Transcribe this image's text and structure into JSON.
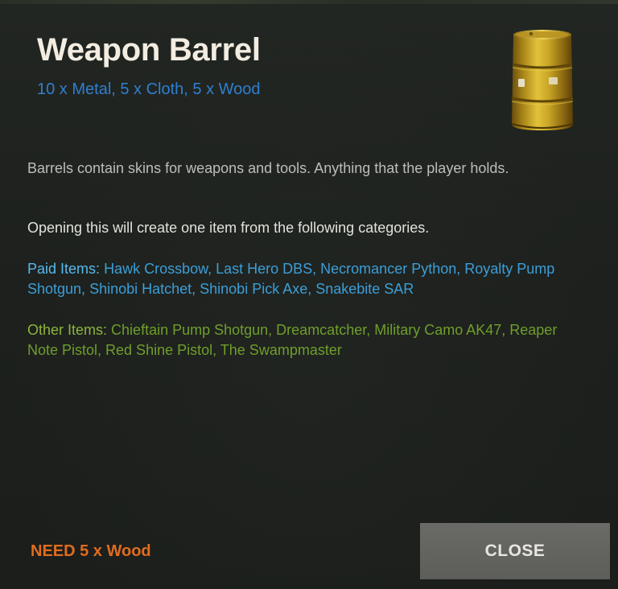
{
  "item": {
    "title": "Weapon Barrel",
    "cost": "10 x Metal, 5 x Cloth, 5 x Wood",
    "image_icon": "barrel-icon"
  },
  "description": "Barrels contain skins for weapons and tools. Anything that the player holds.",
  "intro": "Opening this will create one item from the following categories.",
  "paid_items": {
    "label": "Paid Items:",
    "list": "Hawk Crossbow, Last Hero DBS, Necromancer Python, Royalty Pump Shotgun, Shinobi Hatchet, Shinobi Pick Axe, Snakebite SAR"
  },
  "other_items": {
    "label": "Other Items:",
    "list": "Chieftain Pump Shotgun, Dreamcatcher, Military Camo AK47, Reaper Note Pistol, Red Shine Pistol, The Swampmaster"
  },
  "footer": {
    "need_text": "NEED 5 x Wood",
    "close_label": "CLOSE"
  },
  "colors": {
    "title": "#f3ece1",
    "cost": "#2f7fcf",
    "paid_label": "#56b9ee",
    "paid_list": "#3c9ed8",
    "other_label": "#8cb53a",
    "other_list": "#6f9e2b",
    "need": "#e06c1f",
    "close_button": "#626260"
  }
}
